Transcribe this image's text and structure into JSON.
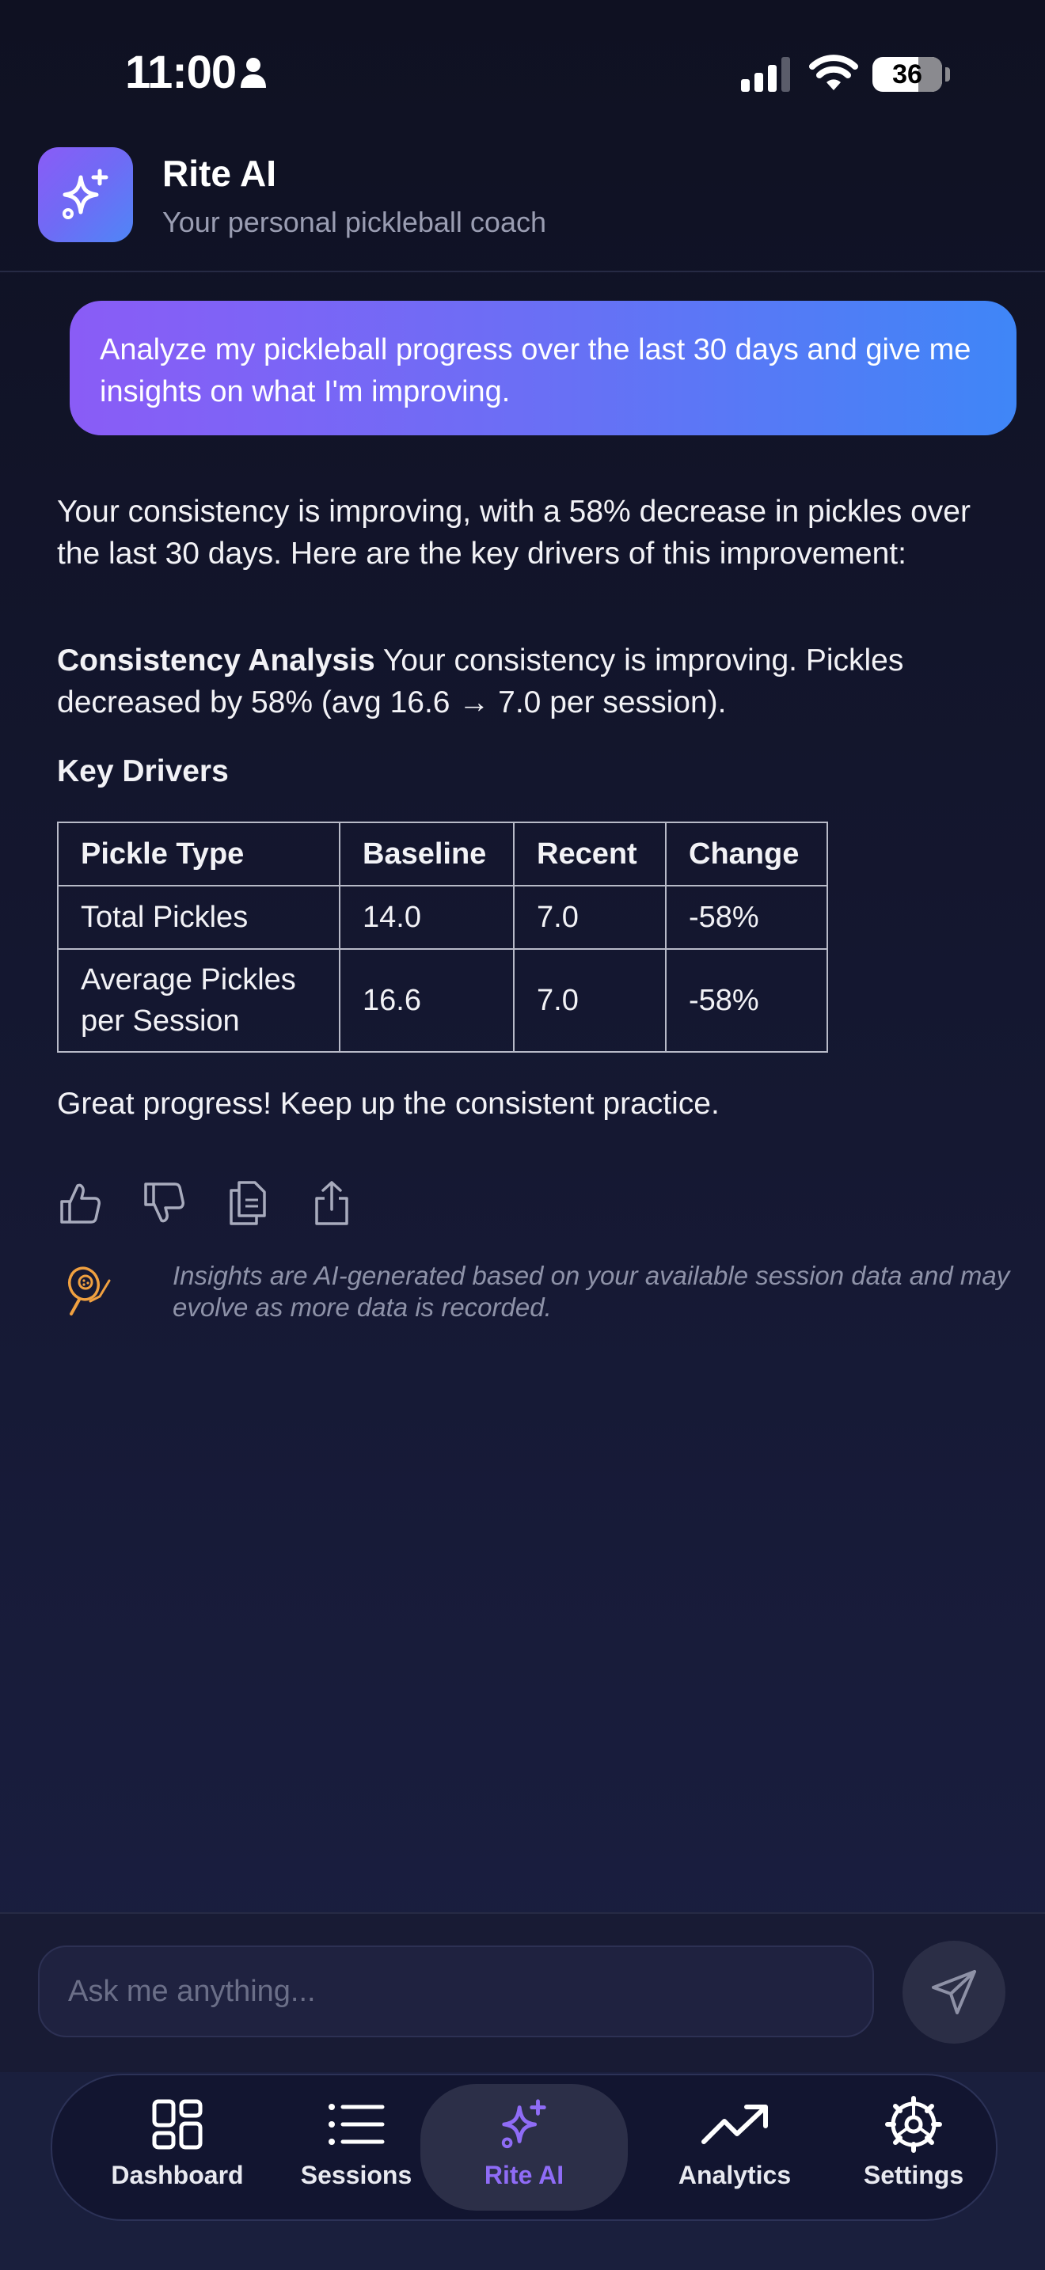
{
  "status_bar": {
    "time": "11:00",
    "battery": "36"
  },
  "header": {
    "title": "Rite AI",
    "subtitle": "Your personal pickleball coach"
  },
  "conversation": {
    "user_message": "Analyze my pickleball progress over the last 30 days and give me insights on what I'm improving.",
    "ai_intro": "Your consistency is improving, with a 58% decrease in pickles over the last 30 days. Here are the key drivers of this improvement:",
    "analysis_heading": "Consistency Analysis",
    "analysis_text": "Your consistency is improving. Pickles decreased by 58% (avg 16.6 → 7.0 per session).",
    "drivers_heading": "Key Drivers",
    "table": {
      "headers": [
        "Pickle Type",
        "Baseline",
        "Recent",
        "Change"
      ],
      "rows": [
        [
          "Total Pickles",
          "14.0",
          "7.0",
          "-58%"
        ],
        [
          "Average Pickles per Session",
          "16.6",
          "7.0",
          "-58%"
        ]
      ]
    },
    "closing": "Great progress! Keep up the consistent practice.",
    "action_icons": [
      "thumbs-up-icon",
      "thumbs-down-icon",
      "copy-icon",
      "share-icon"
    ],
    "disclaimer": "Insights are AI-generated based on your available session data and may evolve as more data is recorded."
  },
  "composer": {
    "placeholder": "Ask me anything..."
  },
  "tabs": [
    {
      "label": "Dashboard",
      "icon": "dashboard-icon"
    },
    {
      "label": "Sessions",
      "icon": "list-icon"
    },
    {
      "label": "Rite AI",
      "icon": "sparkle-icon",
      "active": true
    },
    {
      "label": "Analytics",
      "icon": "trending-up-icon"
    },
    {
      "label": "Settings",
      "icon": "gear-icon"
    }
  ],
  "colors": {
    "accent": "#8f6cf6",
    "bubble_start": "#8a5cf6",
    "bubble_end": "#3f86f7",
    "disclaimer_icon": "#f0a040"
  }
}
